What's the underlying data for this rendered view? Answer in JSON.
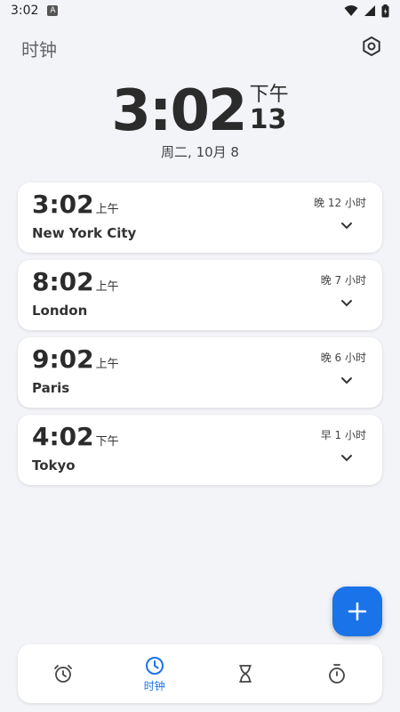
{
  "status_bar": {
    "time": "3:02",
    "notification_badge": "A",
    "icons": [
      "wifi-icon",
      "signal-icon",
      "battery-icon"
    ]
  },
  "header": {
    "title": "时钟",
    "settings_icon": "gear-icon"
  },
  "clock": {
    "time": "3:02",
    "ampm": "下午",
    "seconds": "13",
    "date": "周二, 10月 8"
  },
  "cities": [
    {
      "time": "3:02",
      "ampm": "上午",
      "name": "New York City",
      "diff": "晚 12 小时"
    },
    {
      "time": "8:02",
      "ampm": "上午",
      "name": "London",
      "diff": "晚 7 小时"
    },
    {
      "time": "9:02",
      "ampm": "上午",
      "name": "Paris",
      "diff": "晚 6 小时"
    },
    {
      "time": "4:02",
      "ampm": "下午",
      "name": "Tokyo",
      "diff": "早 1 小时"
    }
  ],
  "fab": {
    "icon": "plus-icon"
  },
  "nav": {
    "active_label": "时钟",
    "items": [
      "alarm-icon",
      "clock-icon",
      "hourglass-icon",
      "stopwatch-icon"
    ]
  },
  "colors": {
    "accent": "#1a73e8",
    "background": "#f3f4f8",
    "card": "#ffffff"
  }
}
